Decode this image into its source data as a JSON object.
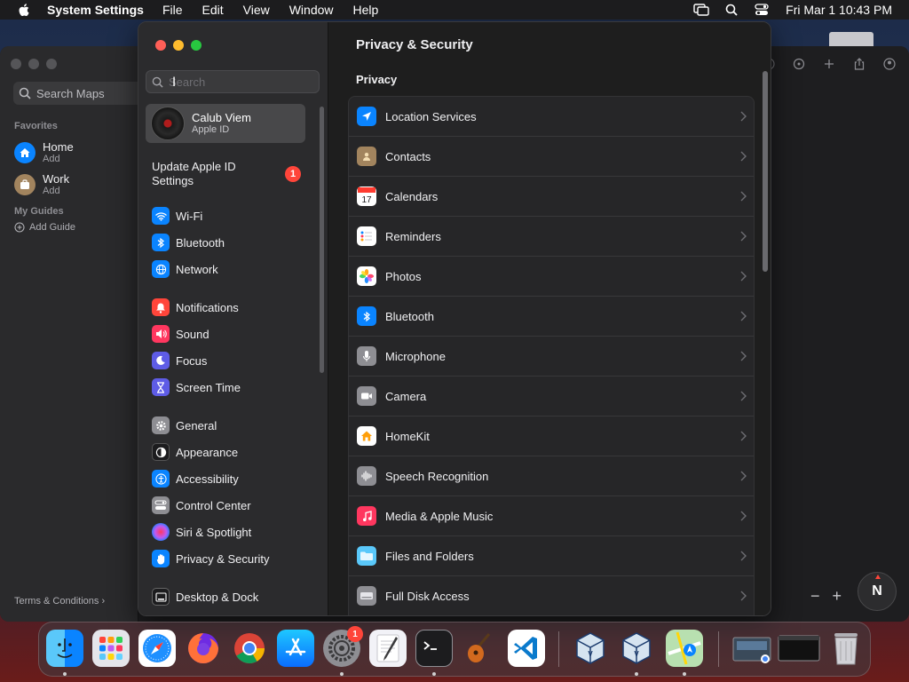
{
  "menubar": {
    "app_name": "System Settings",
    "menus": [
      "File",
      "Edit",
      "View",
      "Window",
      "Help"
    ],
    "clock": "Fri Mar 1  10:43 PM"
  },
  "maps": {
    "search_placeholder": "Search Maps",
    "favorites_heading": "Favorites",
    "home_title": "Home",
    "home_sub": "Add",
    "work_title": "Work",
    "work_sub": "Add",
    "guides_heading": "My Guides",
    "add_guide": "Add Guide",
    "terms": "Terms & Conditions",
    "compass": "N",
    "zoom_out": "−",
    "zoom_in": "+"
  },
  "settings": {
    "search_placeholder": "Search",
    "account_name": "Calub Viem",
    "account_sub": "Apple ID",
    "update_text": "Update Apple ID Settings",
    "update_badge": "1",
    "sidebar_items": [
      {
        "label": "Wi-Fi",
        "icon": "wifi-icon",
        "color": "#0a84ff"
      },
      {
        "label": "Bluetooth",
        "icon": "bluetooth-icon",
        "color": "#0a84ff"
      },
      {
        "label": "Network",
        "icon": "globe-icon",
        "color": "#0a84ff"
      },
      {
        "label": "Notifications",
        "icon": "bell-icon",
        "color": "#ff453a"
      },
      {
        "label": "Sound",
        "icon": "speaker-icon",
        "color": "#ff375f"
      },
      {
        "label": "Focus",
        "icon": "moon-icon",
        "color": "#5e5ce6"
      },
      {
        "label": "Screen Time",
        "icon": "hourglass-icon",
        "color": "#5e5ce6"
      },
      {
        "label": "General",
        "icon": "gear-icon",
        "color": "#8e8e93"
      },
      {
        "label": "Appearance",
        "icon": "appearance-icon",
        "color": "#1c1c1e"
      },
      {
        "label": "Accessibility",
        "icon": "accessibility-icon",
        "color": "#0a84ff"
      },
      {
        "label": "Control Center",
        "icon": "control-center-icon",
        "color": "#8e8e93"
      },
      {
        "label": "Siri & Spotlight",
        "icon": "siri-icon",
        "color": "#bf5af2"
      },
      {
        "label": "Privacy & Security",
        "icon": "hand-icon",
        "color": "#0a84ff"
      },
      {
        "label": "Desktop & Dock",
        "icon": "dock-icon",
        "color": "#1c1c1e"
      }
    ],
    "page_title": "Privacy & Security",
    "section_title": "Privacy",
    "rows": [
      {
        "label": "Location Services",
        "icon": "location-arrow-icon",
        "color": "#0a84ff"
      },
      {
        "label": "Contacts",
        "icon": "contacts-icon",
        "color": "#a2845e"
      },
      {
        "label": "Calendars",
        "icon": "calendar-icon",
        "color": "#ffffff"
      },
      {
        "label": "Reminders",
        "icon": "reminders-icon",
        "color": "#ffffff"
      },
      {
        "label": "Photos",
        "icon": "photos-icon",
        "color": "#ffffff"
      },
      {
        "label": "Bluetooth",
        "icon": "bluetooth-icon",
        "color": "#0a84ff"
      },
      {
        "label": "Microphone",
        "icon": "microphone-icon",
        "color": "#8e8e93"
      },
      {
        "label": "Camera",
        "icon": "camera-icon",
        "color": "#8e8e93"
      },
      {
        "label": "HomeKit",
        "icon": "home-icon",
        "color": "#ffffff"
      },
      {
        "label": "Speech Recognition",
        "icon": "waveform-icon",
        "color": "#8e8e93"
      },
      {
        "label": "Media & Apple Music",
        "icon": "music-note-icon",
        "color": "#ff375f"
      },
      {
        "label": "Files and Folders",
        "icon": "folder-icon",
        "color": "#5ac8fa"
      },
      {
        "label": "Full Disk Access",
        "icon": "disk-icon",
        "color": "#8e8e93"
      }
    ]
  },
  "dock": {
    "apps": [
      "Finder",
      "Launchpad",
      "Safari",
      "Firefox",
      "Chrome",
      "App Store",
      "System Settings",
      "TextEdit",
      "Terminal",
      "GarageBand",
      "Visual Studio Code",
      "VirtualBox",
      "VirtualBox",
      "Maps",
      "Screenshot",
      "Window",
      "Trash"
    ],
    "settings_badge": "1"
  }
}
